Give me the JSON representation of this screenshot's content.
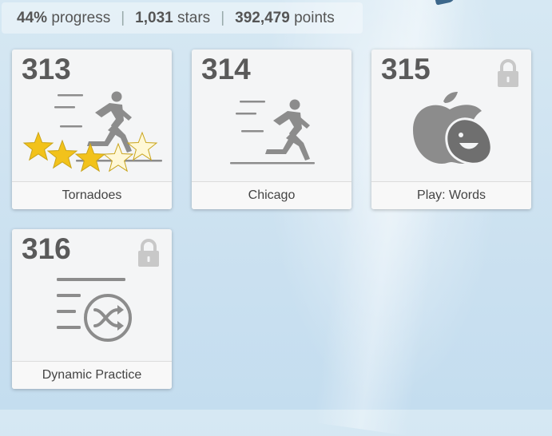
{
  "stats": {
    "progress_value": "44%",
    "progress_label": "progress",
    "stars_value": "1,031",
    "stars_label": "stars",
    "points_value": "392,479",
    "points_label": "points",
    "separator": "|"
  },
  "lessons": [
    {
      "number": "313",
      "title": "Tornadoes",
      "locked": false,
      "icon": "running-person-icon",
      "stars_earned": 3,
      "stars_total": 5
    },
    {
      "number": "314",
      "title": "Chicago",
      "locked": false,
      "icon": "running-person-icon"
    },
    {
      "number": "315",
      "title": "Play: Words",
      "locked": true,
      "icon": "apple-face-icon"
    },
    {
      "number": "316",
      "title": "Dynamic Practice",
      "locked": true,
      "icon": "shuffle-list-icon"
    }
  ],
  "colors": {
    "star_fill": "#f2c21b",
    "star_empty": "#fff8d6",
    "icon_gray": "#8a8a8a",
    "lock_gray": "#c8c8c8"
  }
}
